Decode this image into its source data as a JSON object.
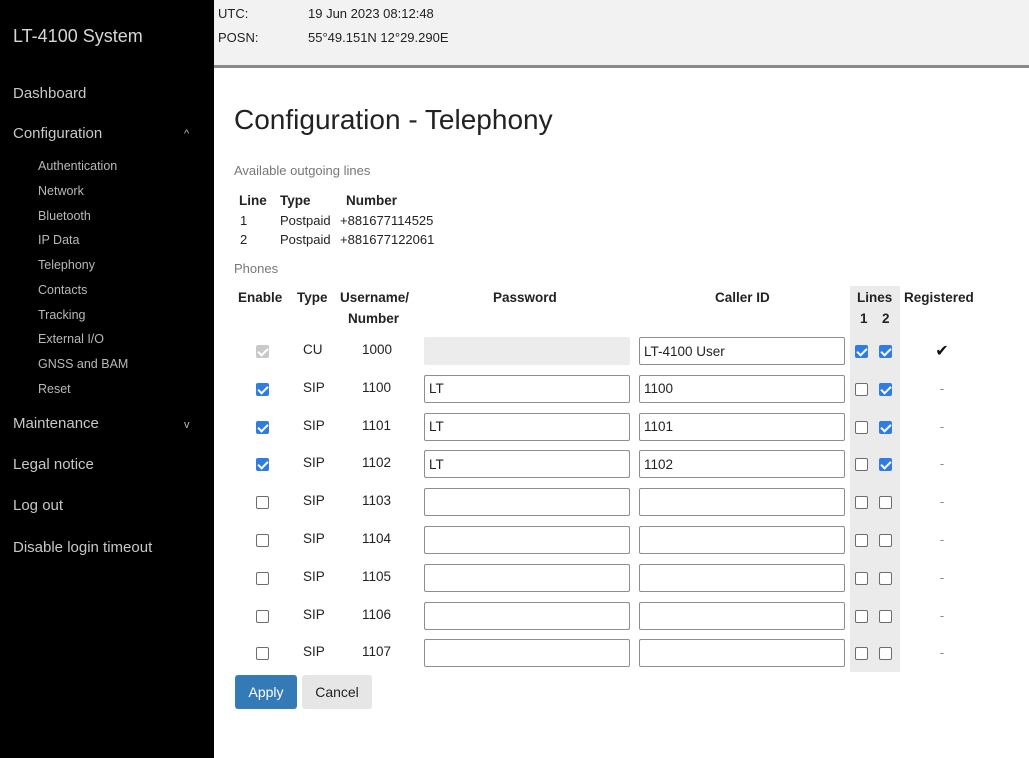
{
  "app": {
    "title": "LT-4100 System"
  },
  "nav": {
    "dashboard": "Dashboard",
    "configuration": "Configuration",
    "configuration_items": [
      "Authentication",
      "Network",
      "Bluetooth",
      "IP Data",
      "Telephony",
      "Contacts",
      "Tracking",
      "External I/O",
      "GNSS and BAM",
      "Reset"
    ],
    "maintenance": "Maintenance",
    "legal": "Legal notice",
    "logout": "Log out",
    "disable_timeout": "Disable login timeout",
    "caret_up": "^",
    "caret_down": "v"
  },
  "status": {
    "utc_label": "UTC:",
    "utc_value": "19 Jun 2023 08:12:48",
    "posn_label": "POSN:",
    "posn_value": "55°49.151N 12°29.290E"
  },
  "page": {
    "title": "Configuration - Telephony"
  },
  "outgoing": {
    "label": "Available outgoing lines",
    "headers": {
      "line": "Line",
      "type": "Type",
      "number": "Number"
    },
    "rows": [
      {
        "line": "1",
        "type": "Postpaid",
        "number": "+881677114525"
      },
      {
        "line": "2",
        "type": "Postpaid",
        "number": "+881677122061"
      }
    ]
  },
  "phones": {
    "label": "Phones",
    "headers": {
      "enable": "Enable",
      "type": "Type",
      "username_1": "Username/",
      "username_2": "Number",
      "password": "Password",
      "caller_id": "Caller ID",
      "lines": "Lines",
      "line1": "1",
      "line2": "2",
      "registered": "Registered"
    },
    "rows": [
      {
        "enabled": true,
        "enable_disabled": true,
        "type": "CU",
        "number": "1000",
        "password": "",
        "password_disabled": true,
        "caller_id": "LT-4100 User",
        "line1": true,
        "line2": true,
        "registered": "✔",
        "registered_ok": true
      },
      {
        "enabled": true,
        "type": "SIP",
        "number": "1100",
        "password": "LT",
        "caller_id": "1100",
        "line1": false,
        "line2": true,
        "registered": "-"
      },
      {
        "enabled": true,
        "type": "SIP",
        "number": "1101",
        "password": "LT",
        "caller_id": "1101",
        "line1": false,
        "line2": true,
        "registered": "-"
      },
      {
        "enabled": true,
        "type": "SIP",
        "number": "1102",
        "password": "LT",
        "caller_id": "1102",
        "line1": false,
        "line2": true,
        "registered": "-"
      },
      {
        "enabled": false,
        "type": "SIP",
        "number": "1103",
        "password": "",
        "caller_id": "",
        "line1": false,
        "line2": false,
        "registered": "-"
      },
      {
        "enabled": false,
        "type": "SIP",
        "number": "1104",
        "password": "",
        "caller_id": "",
        "line1": false,
        "line2": false,
        "registered": "-"
      },
      {
        "enabled": false,
        "type": "SIP",
        "number": "1105",
        "password": "",
        "caller_id": "",
        "line1": false,
        "line2": false,
        "registered": "-"
      },
      {
        "enabled": false,
        "type": "SIP",
        "number": "1106",
        "password": "",
        "caller_id": "",
        "line1": false,
        "line2": false,
        "registered": "-"
      },
      {
        "enabled": false,
        "type": "SIP",
        "number": "1107",
        "password": "",
        "caller_id": "",
        "line1": false,
        "line2": false,
        "registered": "-"
      }
    ]
  },
  "actions": {
    "apply": "Apply",
    "cancel": "Cancel"
  }
}
